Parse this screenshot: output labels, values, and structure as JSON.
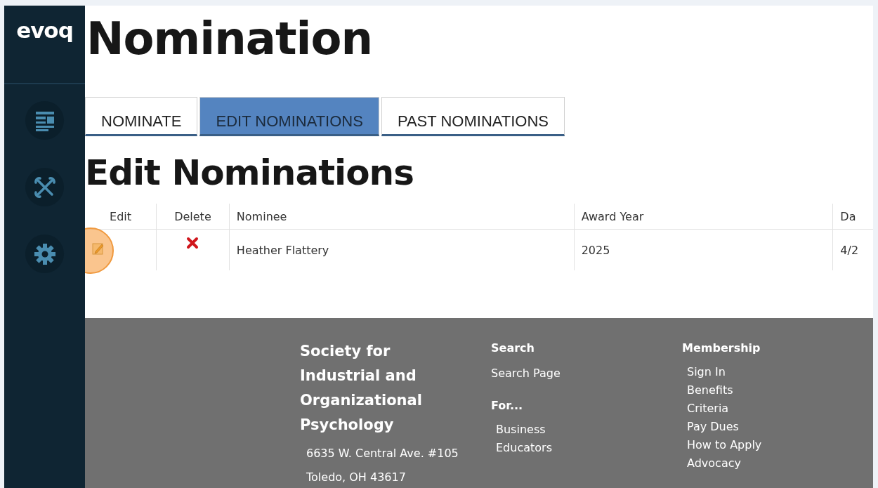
{
  "sidebar": {
    "logo": "evoq",
    "items": [
      {
        "kind": "content"
      },
      {
        "kind": "tools"
      },
      {
        "kind": "settings"
      }
    ]
  },
  "page_title": "Nomination",
  "tabs": [
    {
      "label": "NOMINATE",
      "selected": false
    },
    {
      "label": "EDIT NOMINATIONS",
      "selected": true
    },
    {
      "label": "PAST NOMINATIONS",
      "selected": false
    }
  ],
  "section_heading": "Edit Nominations",
  "table": {
    "columns": [
      "Edit",
      "Delete",
      "Nominee",
      "Award Year",
      "Da"
    ],
    "rows": [
      {
        "nominee": "Heather Flattery",
        "award_year": "2025",
        "column_5": "4/2"
      }
    ]
  },
  "click_highlight": true,
  "footer": {
    "organization": "Society for Industrial and Organizational Psychology",
    "address": [
      "6635 W. Central Ave. #105",
      "Toledo, OH 43617"
    ],
    "search": {
      "heading": "Search",
      "links": [
        "Search Page"
      ]
    },
    "for": {
      "heading": "For...",
      "links": [
        "Business",
        "Educators"
      ]
    },
    "membership": {
      "heading": "Membership",
      "links": [
        "Sign In",
        "Benefits",
        "Criteria",
        "Pay Dues",
        "How to Apply",
        "Advocacy"
      ]
    }
  }
}
